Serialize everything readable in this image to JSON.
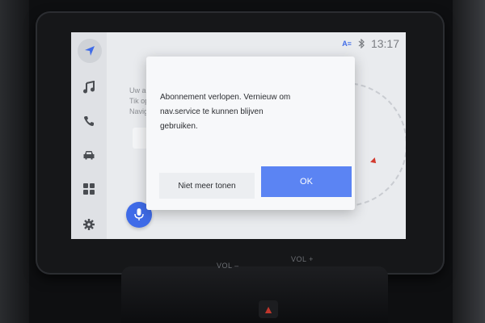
{
  "status_bar": {
    "time": "13:17",
    "icons": [
      "screen-share-icon",
      "bluetooth-icon"
    ]
  },
  "sidebar": {
    "items": [
      {
        "icon": "navigation-icon"
      },
      {
        "icon": "music-note-icon"
      },
      {
        "icon": "phone-icon"
      },
      {
        "icon": "car-icon"
      },
      {
        "icon": "apps-grid-icon"
      },
      {
        "icon": "gear-icon"
      }
    ]
  },
  "background_text": {
    "line1": "Uw ab",
    "line2": "Tik op",
    "line3": "Navig"
  },
  "dialog": {
    "message": "Abonnement verlopen. Vernieuw om nav.service te kunnen blijven gebruiken.",
    "secondary_label": "Niet meer tonen",
    "primary_label": "OK"
  },
  "hardware": {
    "vol_minus": "VOL –",
    "vol_plus": "VOL +"
  },
  "colors": {
    "accent": "#5b84f3",
    "mic": "#3f6be8"
  }
}
